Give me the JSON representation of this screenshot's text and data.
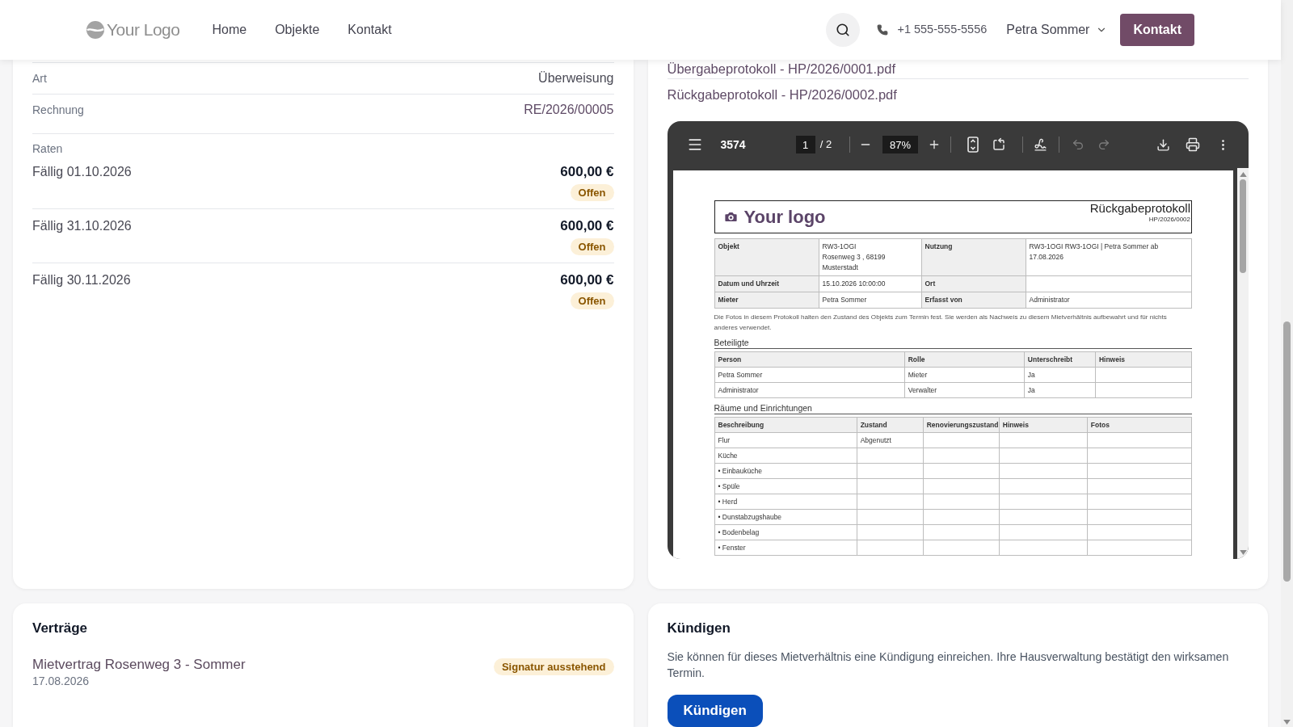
{
  "header": {
    "logo": "Your Logo",
    "nav": [
      {
        "label": "Home"
      },
      {
        "label": "Objekte"
      },
      {
        "label": "Kontakt"
      }
    ],
    "phone": "+1 555-555-5556",
    "user": "Petra Sommer",
    "button": "Kontakt"
  },
  "payment": {
    "fields": [
      {
        "label": "Art",
        "value": "Überweisung",
        "kind": "text"
      },
      {
        "label": "Rechnung",
        "value": "RE/2026/00005",
        "kind": "link"
      }
    ],
    "installments_label": "Raten",
    "installments": [
      {
        "due": "Fällig 01.10.2026",
        "amount": "600,00 €",
        "status": "Offen"
      },
      {
        "due": "Fällig 31.10.2026",
        "amount": "600,00 €",
        "status": "Offen"
      },
      {
        "due": "Fällig 30.11.2026",
        "amount": "600,00 €",
        "status": "Offen"
      }
    ]
  },
  "documents": {
    "files": [
      "Übergabeprotokoll - HP/2026/0001.pdf",
      "Rückgabeprotokoll - HP/2026/0002.pdf"
    ],
    "viewer": {
      "title": "3574",
      "page": "1",
      "page_count": "/ 2",
      "zoom": "87%",
      "undo_disabled": true,
      "redo_disabled": true,
      "document": {
        "logo": "Your logo",
        "title": "Rückgabeprotokoll",
        "reference": "HP/2026/0002",
        "info_rows": [
          {
            "pairs": [
              {
                "label": "Objekt",
                "lines": [
                  "RW3-1OGI",
                  "Rosenweg 3 , 68199",
                  "Musterstadt"
                ]
              },
              {
                "label": "Nutzung",
                "lines": [
                  "RW3-1OGI RW3-1OGI | Petra Sommer ab 17.08.2026"
                ]
              }
            ]
          },
          {
            "pairs": [
              {
                "label": "Datum und Uhrzeit",
                "lines": [
                  "15.10.2026 10:00:00"
                ]
              },
              {
                "label": "Ort"
              }
            ]
          },
          {
            "pairs": [
              {
                "label": "Mieter",
                "lines": [
                  "Petra Sommer"
                ]
              },
              {
                "label": "Erfasst von",
                "lines": [
                  "Administrator"
                ]
              }
            ]
          }
        ],
        "note": "Die Fotos in diesem Protokoll halten den Zustand des Objekts zum Termin fest. Sie werden als Nachweis zu diesem Mietverhältnis aufbewahrt und für nichts anderes verwendet.",
        "sections": [
          {
            "title": "Beteiligte",
            "columns": [
              "Person",
              "Rolle",
              "Unterschreibt",
              "Hinweis"
            ],
            "rows": [
              [
                "Petra Sommer",
                "Mieter",
                "Ja"
              ],
              [
                "Administrator",
                "Verwalter",
                "Ja"
              ]
            ]
          },
          {
            "title": "Räume und Einrichtungen",
            "columns": [
              "Beschreibung",
              "Zustand",
              "Renovierungszustand",
              "Hinweis",
              "Fotos"
            ],
            "rows": [
              [
                "Flur",
                "Abgenutzt"
              ],
              [
                "Küche"
              ],
              [
                "• Einbauküche"
              ],
              [
                "• Spüle"
              ],
              [
                "• Herd"
              ],
              [
                "• Dunstabzugshaube"
              ],
              [
                "• Bodenbelag"
              ],
              [
                "• Fenster"
              ]
            ]
          }
        ]
      }
    }
  },
  "contracts": {
    "title": "Verträge",
    "items": [
      {
        "name": "Mietvertrag Rosenweg 3 - Sommer",
        "date": "17.08.2026",
        "status": "Signatur ausstehend"
      }
    ]
  },
  "termination": {
    "title": "Kündigen",
    "text": "Sie können für dieses Mietverhältnis eine Kündigung einreichen. Ihre Hausverwaltung bestätigt den wirksamen Termin.",
    "button": "Kündigen"
  }
}
